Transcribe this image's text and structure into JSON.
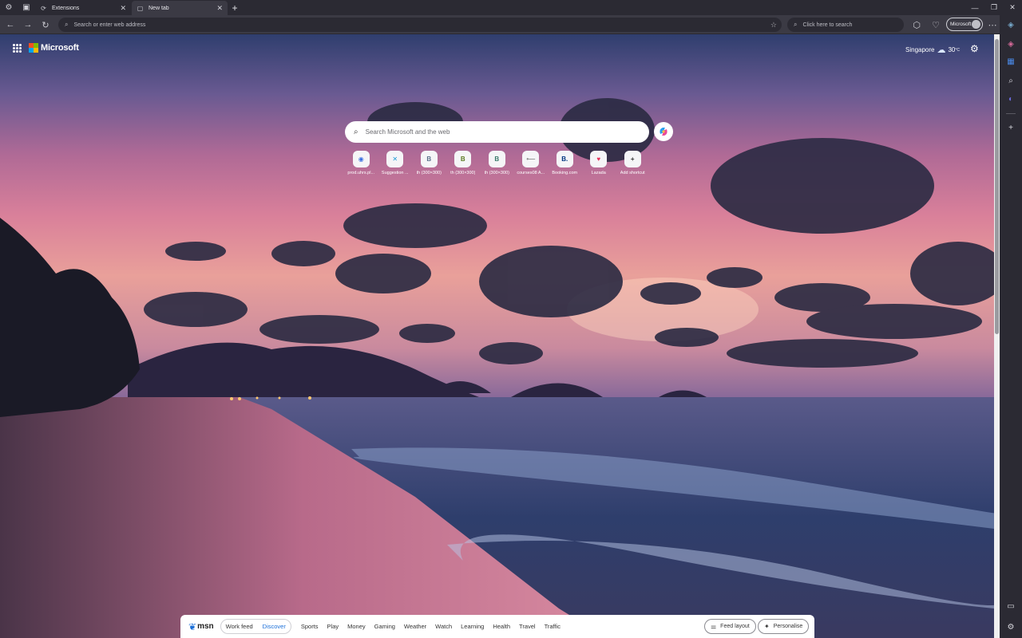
{
  "tabs": [
    {
      "label": "Extensions",
      "icon": "extensions-icon"
    },
    {
      "label": "New tab",
      "icon": "newtab-page-icon",
      "active": true
    }
  ],
  "toolbar": {
    "address_placeholder": "Search or enter web address",
    "search_placeholder": "Click here to search",
    "profile_label": "Microsoft"
  },
  "page": {
    "brand": "Microsoft",
    "weather_city": "Singapore",
    "weather_temp": "30",
    "weather_unit": "°C",
    "search_placeholder": "Search Microsoft and the web"
  },
  "shortcuts": [
    {
      "label": "prod.uhrs.pl...",
      "glyph": "◉",
      "color": "#3a6fe0"
    },
    {
      "label": "Suggestion ...",
      "glyph": "✕",
      "color": "#1a9ad6"
    },
    {
      "label": "th (300×300)",
      "glyph": "B",
      "color": "#5a6f8a"
    },
    {
      "label": "th (300×300)",
      "glyph": "B",
      "color": "#5a7a20"
    },
    {
      "label": "th (300×300)",
      "glyph": "B",
      "color": "#3a7a6a"
    },
    {
      "label": "courses08 A...",
      "glyph": "•—",
      "color": "#888888"
    },
    {
      "label": "Booking.com",
      "glyph": "B.",
      "color": "#003580"
    },
    {
      "label": "Lazada",
      "glyph": "♥",
      "color": "#e8305a"
    },
    {
      "label": "Add shortcut",
      "glyph": "+",
      "color": "#333333"
    }
  ],
  "feed": {
    "brand": "msn",
    "tab_work": "Work feed",
    "tab_discover": "Discover",
    "categories": [
      "Sports",
      "Play",
      "Money",
      "Gaming",
      "Weather",
      "Watch",
      "Learning",
      "Health",
      "Travel",
      "Traffic"
    ],
    "layout_btn": "Feed layout",
    "personalise_btn": "Personalise"
  }
}
